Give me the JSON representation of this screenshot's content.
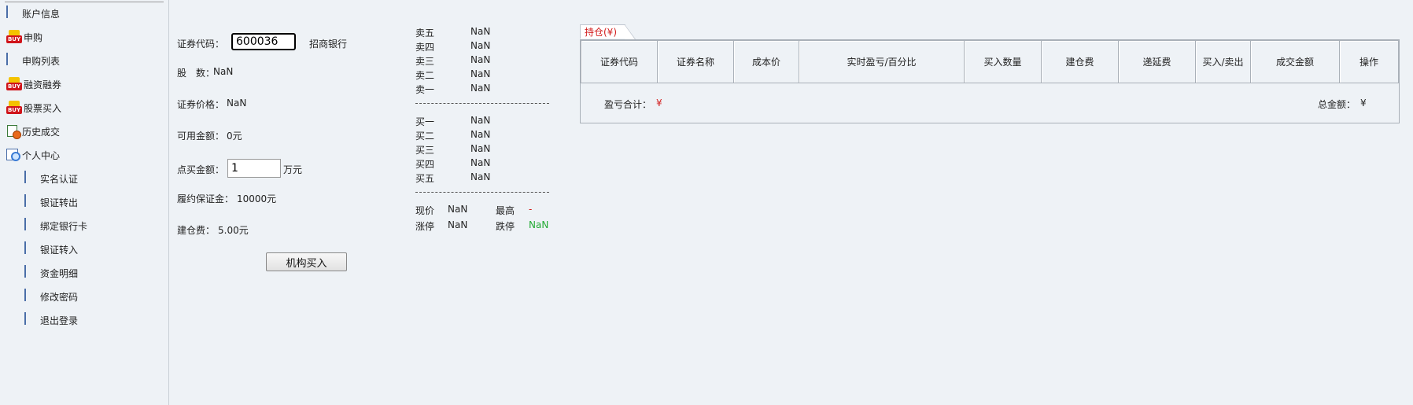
{
  "sidebar": {
    "items": [
      {
        "label": "账户信息",
        "icon": "document-icon"
      },
      {
        "label": "申购",
        "icon": "buy-icon"
      },
      {
        "label": "申购列表",
        "icon": "document-icon"
      },
      {
        "label": "融资融券",
        "icon": "buy-icon"
      },
      {
        "label": "股票买入",
        "icon": "buy-icon"
      },
      {
        "label": "历史成交",
        "icon": "history-icon"
      },
      {
        "label": "个人中心",
        "icon": "search-doc-icon"
      },
      {
        "label": "实名认证",
        "icon": "document-icon"
      },
      {
        "label": "银证转出",
        "icon": "document-icon"
      },
      {
        "label": "绑定银行卡",
        "icon": "document-icon"
      },
      {
        "label": "银证转入",
        "icon": "document-icon"
      },
      {
        "label": "资金明细",
        "icon": "document-icon"
      },
      {
        "label": "修改密码",
        "icon": "document-icon"
      },
      {
        "label": "退出登录",
        "icon": "document-icon"
      }
    ],
    "buy_icon_text": "BUY"
  },
  "form": {
    "code_label": "证券代码：",
    "code_value": "600036",
    "stock_name": "招商银行",
    "shares_label": "股　数：",
    "shares_value": "NaN",
    "price_label": "证券价格：",
    "price_value": "NaN",
    "available_label": "可用金额：",
    "available_value": "0元",
    "amount_label": "点买金额：",
    "amount_value": "1",
    "amount_unit": "万元",
    "margin_label": "履约保证金：",
    "margin_value": "10000元",
    "fee_label": "建仓费：",
    "fee_value": "5.00元",
    "buy_button": "机构买入"
  },
  "quote": {
    "sell": [
      {
        "label": "卖五",
        "value": "NaN"
      },
      {
        "label": "卖四",
        "value": "NaN"
      },
      {
        "label": "卖三",
        "value": "NaN"
      },
      {
        "label": "卖二",
        "value": "NaN"
      },
      {
        "label": "卖一",
        "value": "NaN"
      }
    ],
    "buy": [
      {
        "label": "买一",
        "value": "NaN"
      },
      {
        "label": "买二",
        "value": "NaN"
      },
      {
        "label": "买三",
        "value": "NaN"
      },
      {
        "label": "买四",
        "value": "NaN"
      },
      {
        "label": "买五",
        "value": "NaN"
      }
    ],
    "current_label": "现价",
    "current_value": "NaN",
    "high_label": "最高",
    "high_value": "-",
    "limit_up_label": "涨停",
    "limit_up_value": "NaN",
    "limit_down_label": "跌停",
    "limit_down_value": "NaN"
  },
  "holdings": {
    "tab_label": "持仓(¥)",
    "columns": [
      "证券代码",
      "证券名称",
      "成本价",
      "实时盈亏/百分比",
      "买入数量",
      "建仓费",
      "递延费",
      "买入/卖出",
      "成交金额",
      "操作"
    ],
    "pnl_total_label": "盈亏合计：",
    "pnl_total_value": "¥",
    "total_amount_label": "总金额：",
    "total_amount_value": "¥"
  },
  "colors": {
    "accent_red": "#d21b1b",
    "limit_down_green": "#22aa33",
    "background": "#eef2f6"
  }
}
